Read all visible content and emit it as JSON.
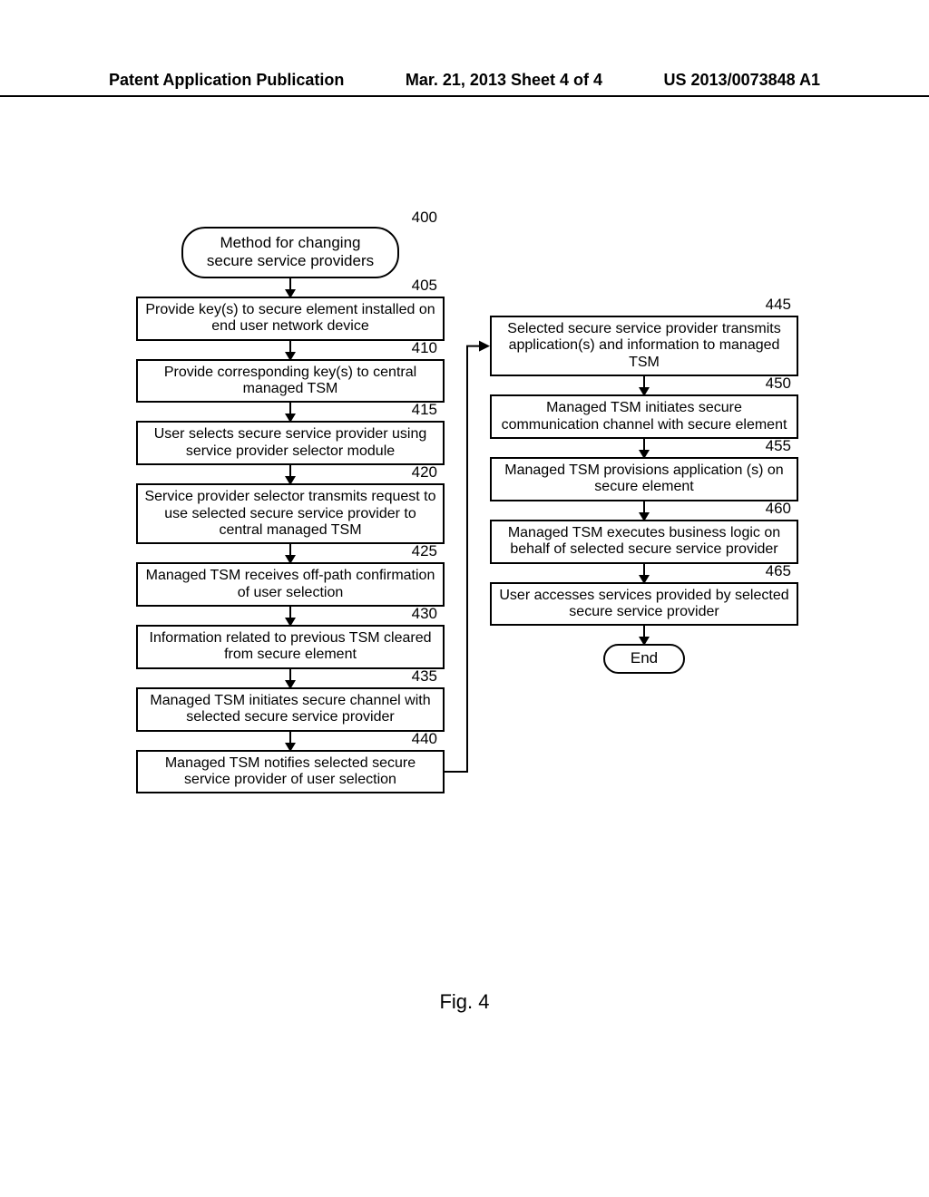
{
  "header": {
    "left": "Patent Application Publication",
    "center": "Mar. 21, 2013  Sheet 4 of 4",
    "right": "US 2013/0073848 A1"
  },
  "chart_data": {
    "type": "flowchart",
    "title_number": "400",
    "title": "Method for changing secure service providers",
    "end_label": "End",
    "figure_label": "Fig. 4",
    "left_steps": [
      {
        "num": "405",
        "text": "Provide key(s) to secure element installed on end user network device"
      },
      {
        "num": "410",
        "text": "Provide corresponding key(s) to central managed TSM"
      },
      {
        "num": "415",
        "text": "User selects secure service provider using service provider selector module"
      },
      {
        "num": "420",
        "text": "Service provider selector transmits request to use selected secure service provider to central managed TSM"
      },
      {
        "num": "425",
        "text": "Managed TSM receives off-path confirmation of user selection"
      },
      {
        "num": "430",
        "text": "Information related to previous TSM cleared from secure element"
      },
      {
        "num": "435",
        "text": "Managed TSM initiates secure channel with selected secure service provider"
      },
      {
        "num": "440",
        "text": "Managed TSM notifies selected secure service provider of user selection"
      }
    ],
    "right_steps": [
      {
        "num": "445",
        "text": "Selected secure service provider transmits application(s) and information to managed TSM"
      },
      {
        "num": "450",
        "text": "Managed TSM initiates secure communication channel with secure element"
      },
      {
        "num": "455",
        "text": "Managed TSM provisions application (s) on secure element"
      },
      {
        "num": "460",
        "text": "Managed TSM executes business logic on behalf of selected secure service provider"
      },
      {
        "num": "465",
        "text": "User accesses services provided by selected secure service provider"
      }
    ],
    "edges": [
      "title→405",
      "405→410",
      "410→415",
      "415→420",
      "420→425",
      "425→430",
      "430→435",
      "435→440",
      "440→445",
      "445→450",
      "450→455",
      "455→460",
      "460→465",
      "465→End"
    ]
  }
}
